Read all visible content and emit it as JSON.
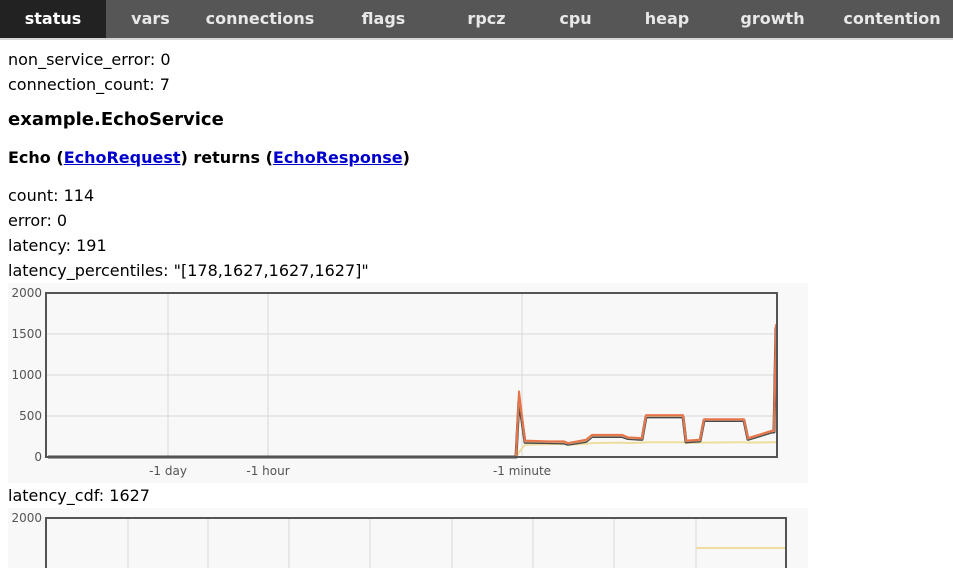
{
  "tabs": [
    {
      "label": "status",
      "active": true
    },
    {
      "label": "vars",
      "active": false
    },
    {
      "label": "connections",
      "active": false
    },
    {
      "label": "flags",
      "active": false
    },
    {
      "label": "rpcz",
      "active": false
    },
    {
      "label": "cpu",
      "active": false
    },
    {
      "label": "heap",
      "active": false
    },
    {
      "label": "growth",
      "active": false
    },
    {
      "label": "contention",
      "active": false
    }
  ],
  "stats": {
    "non_service_error": "non_service_error: 0",
    "connection_count": "connection_count: 7"
  },
  "service": {
    "name": "example.EchoService",
    "method_prefix": "Echo (",
    "request": "EchoRequest",
    "mid": ") returns (",
    "response": "EchoResponse",
    "suffix": ")"
  },
  "method_stats": {
    "count": "count: 114",
    "error": "error: 0",
    "latency": "latency: 191",
    "latency_percentiles": "latency_percentiles: \"[178,1627,1627,1627]\"",
    "latency_cdf": "latency_cdf: 1627"
  },
  "colors": {
    "p99_line": "#e8754a",
    "p90_line": "#c9a27e",
    "avg_line": "#4a4a4a",
    "p50_line": "#eddd9e",
    "grid": "#d8d8d8",
    "plot_bg": "#f8f8f8"
  },
  "chart_data": [
    {
      "type": "line",
      "title": "",
      "xlabel": "",
      "ylabel": "",
      "ylim": [
        0,
        2000
      ],
      "yticks": [
        0,
        500,
        1000,
        1500,
        2000
      ],
      "xtick_labels": [
        "-1 day",
        "-1 hour",
        "-1 minute"
      ],
      "grid": true,
      "series": [
        {
          "key": "p99",
          "values": [
            0,
            0,
            0,
            0,
            800,
            200,
            190,
            190,
            170,
            210,
            270,
            270,
            240,
            230,
            510,
            510,
            510,
            200,
            210,
            460,
            460,
            460,
            230,
            320,
            320,
            1620
          ]
        },
        {
          "key": "p90",
          "values": [
            0,
            0,
            0,
            0,
            770,
            190,
            185,
            180,
            165,
            200,
            260,
            260,
            235,
            225,
            500,
            500,
            500,
            195,
            205,
            455,
            455,
            455,
            225,
            315,
            315,
            1600
          ]
        },
        {
          "key": "avg",
          "values": [
            0,
            0,
            0,
            0,
            700,
            180,
            175,
            170,
            155,
            190,
            250,
            250,
            225,
            215,
            490,
            490,
            490,
            185,
            195,
            445,
            445,
            445,
            215,
            305,
            305,
            1580
          ]
        },
        {
          "key": "p50",
          "values": [
            0,
            0,
            0,
            0,
            60,
            150,
            155,
            160,
            150,
            160,
            170,
            175,
            170,
            175,
            180,
            180,
            180,
            170,
            175,
            175,
            180,
            180,
            175,
            180,
            180,
            178
          ]
        }
      ]
    },
    {
      "type": "line",
      "title": "",
      "ylim": [
        0,
        2000
      ],
      "yticks": [
        2000
      ],
      "grid": true,
      "series": []
    }
  ]
}
